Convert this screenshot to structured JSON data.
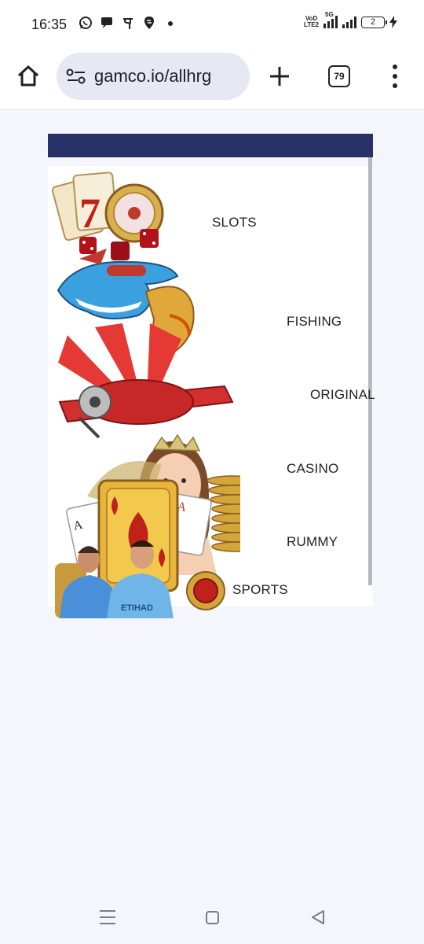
{
  "status_bar": {
    "time": "16:35",
    "app_icons": [
      "whatsapp-icon",
      "chat-bubble-icon",
      "phonepe-icon",
      "swiggy-icon",
      "dot-icon"
    ],
    "network_label_top": "VoD",
    "network_label_bottom": "LTE2",
    "network_type": "5G",
    "battery_level": "2"
  },
  "browser": {
    "url": "gamco.io/allhrg",
    "tab_count": "79"
  },
  "page": {
    "header_color": "#283268",
    "categories": [
      {
        "label": "SLOTS"
      },
      {
        "label": "FISHING"
      },
      {
        "label": "ORIGINAL"
      },
      {
        "label": "CASINO"
      },
      {
        "label": "RUMMY"
      },
      {
        "label": "SPORTS"
      }
    ]
  }
}
